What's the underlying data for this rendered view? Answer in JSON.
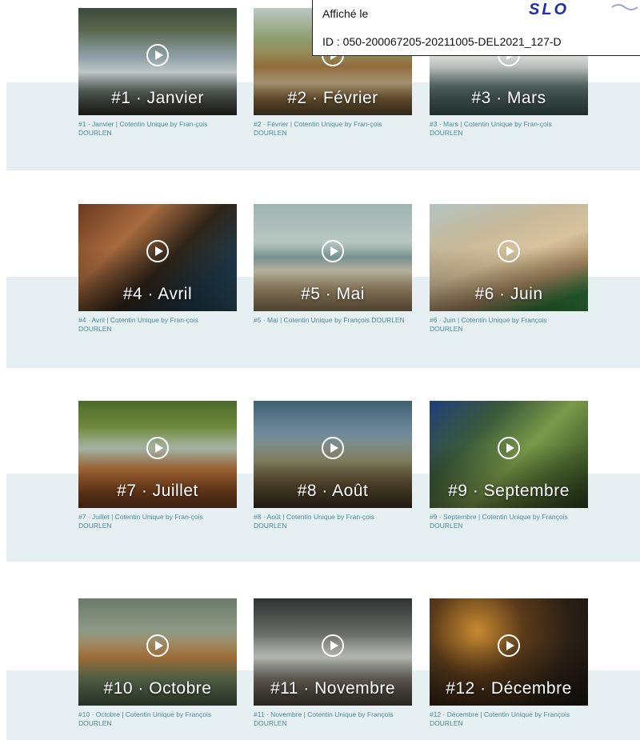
{
  "stamp": {
    "line1": "Affiché le",
    "line2": "ID : 050-200067205-20211005-DEL2021_127-D",
    "logo_text": "SLO"
  },
  "videos": [
    {
      "title": "#1 · Janvier",
      "caption": "#1 · Janvier | Cotentin Unique by Fran-çois DOURLEN"
    },
    {
      "title": "#2 · Février",
      "caption": "#2 · Février | Cotentin Unique by Fran-çois DOURLEN"
    },
    {
      "title": "#3 · Mars",
      "caption": "#3 · Mars | Cotentin Unique by Fran-çois DOURLEN"
    },
    {
      "title": "#4 · Avril",
      "caption": "#4 · Avril | Cotentin Unique by Fran-çois DOURLEN"
    },
    {
      "title": "#5 · Mai",
      "caption": "#5 · Mai | Cotentin Unique by François DOURLEN"
    },
    {
      "title": "#6 · Juin",
      "caption": "#6 · Juin | Cotentin Unique by François DOURLEN"
    },
    {
      "title": "#7 · Juillet",
      "caption": "#7 · Juillet | Cotentin Unique by Fran-çois DOURLEN"
    },
    {
      "title": "#8 · Août",
      "caption": "#8 · Août | Cotentin Unique by Fran-çois DOURLEN"
    },
    {
      "title": "#9 · Septembre",
      "caption": "#9 · Septembre | Cotentin Unique by François DOURLEN"
    },
    {
      "title": "#10 · Octobre",
      "caption": "#10 · Octobre | Cotentin Unique by François DOURLEN"
    },
    {
      "title": "#11 · Novembre",
      "caption": "#11 · Novembre | Cotentin Unique by François DOURLEN"
    },
    {
      "title": "#12 · Décembre",
      "caption": "#12 · Décembre | Cotentin Unique by François DOURLEN"
    }
  ],
  "colors": {
    "band": "#e6f0f3",
    "caption": "#4c8a98"
  }
}
